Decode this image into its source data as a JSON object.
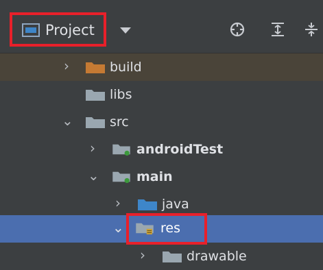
{
  "toolbar": {
    "project_label": "Project",
    "icons": [
      "target-icon",
      "expand-all-icon",
      "collapse-all-icon"
    ]
  },
  "tree": [
    {
      "label": "build",
      "expanded": false,
      "folder_color": "#c57a33"
    },
    {
      "label": "libs",
      "expanded": null,
      "folder_color": "#9aa7b0"
    },
    {
      "label": "src",
      "expanded": true,
      "folder_color": "#9aa7b0"
    },
    {
      "label": "androidTest",
      "expanded": false,
      "bold": true,
      "folder_color": "#9aa7b0"
    },
    {
      "label": "main",
      "expanded": true,
      "bold": true,
      "folder_color": "#9aa7b0"
    },
    {
      "label": "java",
      "expanded": false,
      "folder_color": "#3e86c9"
    },
    {
      "label": "res",
      "expanded": true,
      "selected": true,
      "folder_color": "#9aa7b0"
    },
    {
      "label": "drawable",
      "expanded": false,
      "folder_color": "#9aa7b0"
    }
  ],
  "colors": {
    "panel_bg": "#3c3f41",
    "selection": "#4b6eaf",
    "excluded_row": "#4a4439",
    "highlight_box": "#e8202a"
  }
}
